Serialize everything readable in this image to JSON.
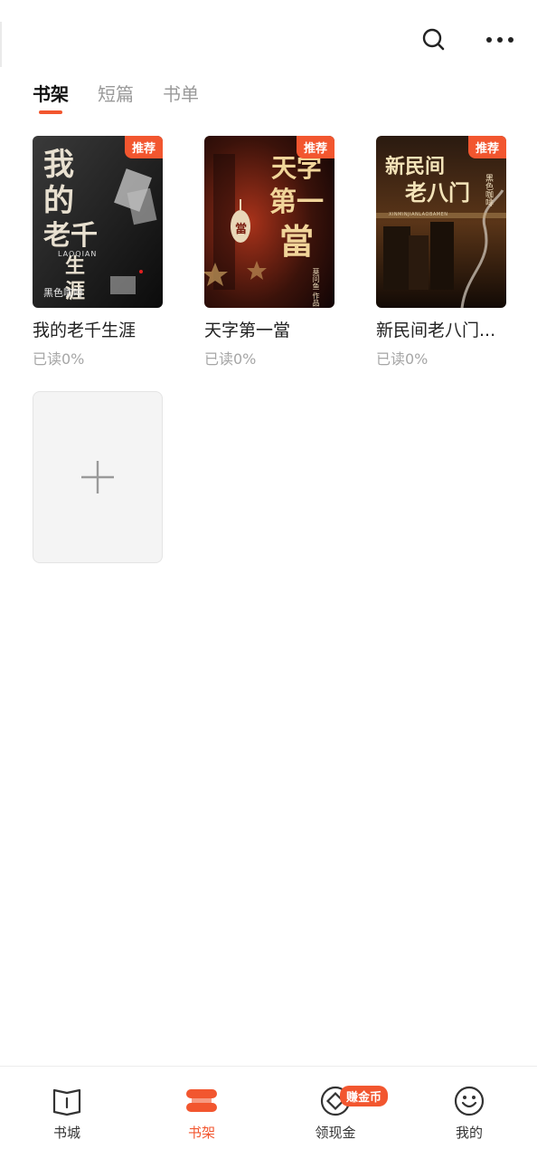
{
  "header": {
    "search_icon": "search-icon",
    "more_icon": "more-icon"
  },
  "tabs": [
    {
      "label": "书架",
      "active": true
    },
    {
      "label": "短篇",
      "active": false
    },
    {
      "label": "书单",
      "active": false
    }
  ],
  "books": [
    {
      "title": "我的老千生涯",
      "progress": "已读0%",
      "badge": "推荐",
      "cover_text": [
        "我的",
        "老千",
        "生涯"
      ],
      "cover_sub": "LAOQIAN",
      "cover_author": "黑色咖啡"
    },
    {
      "title": "天字第一當",
      "progress": "已读0%",
      "badge": "推荐",
      "cover_text": [
        "天字",
        "第一",
        "當"
      ],
      "cover_sub": "當",
      "cover_author": "莫问鱼 作品"
    },
    {
      "title": "新民间老八门...",
      "progress": "已读0%",
      "badge": "推荐",
      "cover_text": [
        "新民间",
        "老八门"
      ],
      "cover_sub": "XINMINJIANLAOBAMEN",
      "cover_author": "黑色咖啡"
    }
  ],
  "add_book": {
    "icon": "plus-icon"
  },
  "bottom_nav": {
    "items": [
      {
        "label": "书城",
        "icon": "book-store-icon",
        "active": false
      },
      {
        "label": "书架",
        "icon": "bookshelf-icon",
        "active": true
      },
      {
        "label": "领现金",
        "icon": "cash-icon",
        "active": false
      },
      {
        "label": "我的",
        "icon": "smile-icon",
        "active": false
      }
    ],
    "coin_badge": "赚金币"
  },
  "colors": {
    "accent": "#f2562f",
    "muted": "#a6a6a6"
  }
}
